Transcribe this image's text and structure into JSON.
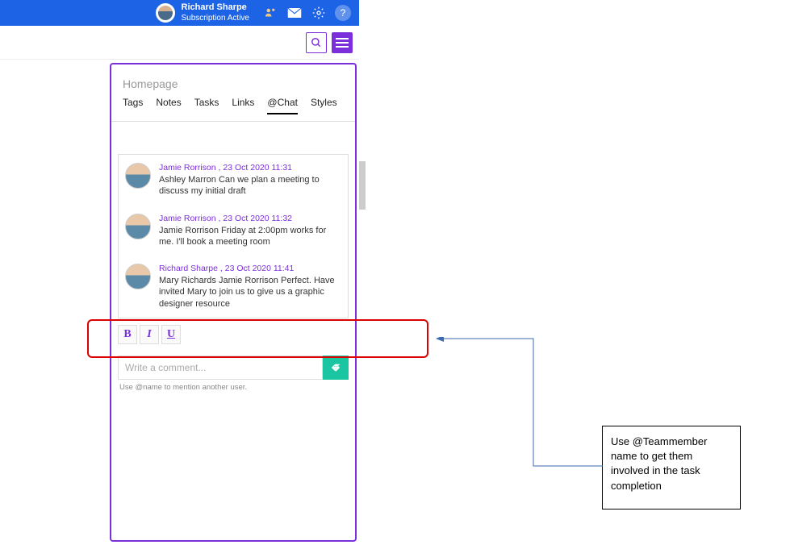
{
  "topbar": {
    "user_name": "Richard Sharpe",
    "user_status": "Subscription Active"
  },
  "panel": {
    "breadcrumb": "Homepage",
    "tabs": [
      {
        "label": "Tags",
        "active": false
      },
      {
        "label": "Notes",
        "active": false
      },
      {
        "label": "Tasks",
        "active": false
      },
      {
        "label": "Links",
        "active": false
      },
      {
        "label": "@Chat",
        "active": true
      },
      {
        "label": "Styles",
        "active": false
      }
    ]
  },
  "messages": [
    {
      "author": "Jamie Rorrison",
      "sep": " , ",
      "time": "23 Oct 2020 11:31",
      "text": "Ashley Marron Can we plan a meeting to discuss my initial draft"
    },
    {
      "author": "Jamie Rorrison",
      "sep": " , ",
      "time": "23 Oct 2020 11:32",
      "text": "Jamie Rorrison Friday at 2:00pm works for me. I'll book a meeting room"
    },
    {
      "author": "Richard Sharpe",
      "sep": " , ",
      "time": "23 Oct 2020 11:41",
      "text": "Mary Richards Jamie Rorrison Perfect. Have invited Mary to join us to give us a graphic designer resource"
    }
  ],
  "format": {
    "bold": "B",
    "italic": "I",
    "underline": "U"
  },
  "compose": {
    "placeholder": "Write a comment...",
    "hint": "Use @name to mention another user."
  },
  "annotation": "Use @Teammember name to get them involved in the task completion"
}
